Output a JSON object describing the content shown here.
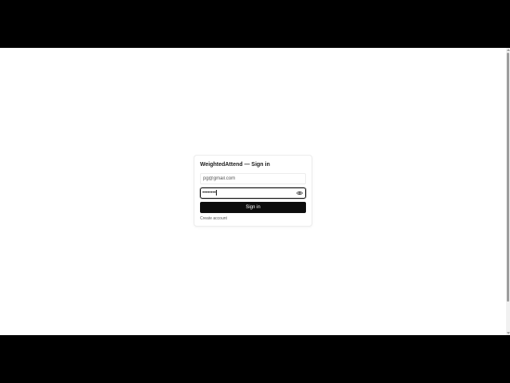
{
  "card": {
    "title": "WeightedAttend — Sign in"
  },
  "form": {
    "email_value": "pg@gmail.com",
    "password_masked": "••••••••",
    "password_visibility_icon": "eye-icon",
    "signin_label": "Sign in",
    "create_account_label": "Create account"
  },
  "colors": {
    "primary_button": "#0d0d0d",
    "page_background": "#ffffff",
    "letterbox": "#000000"
  }
}
